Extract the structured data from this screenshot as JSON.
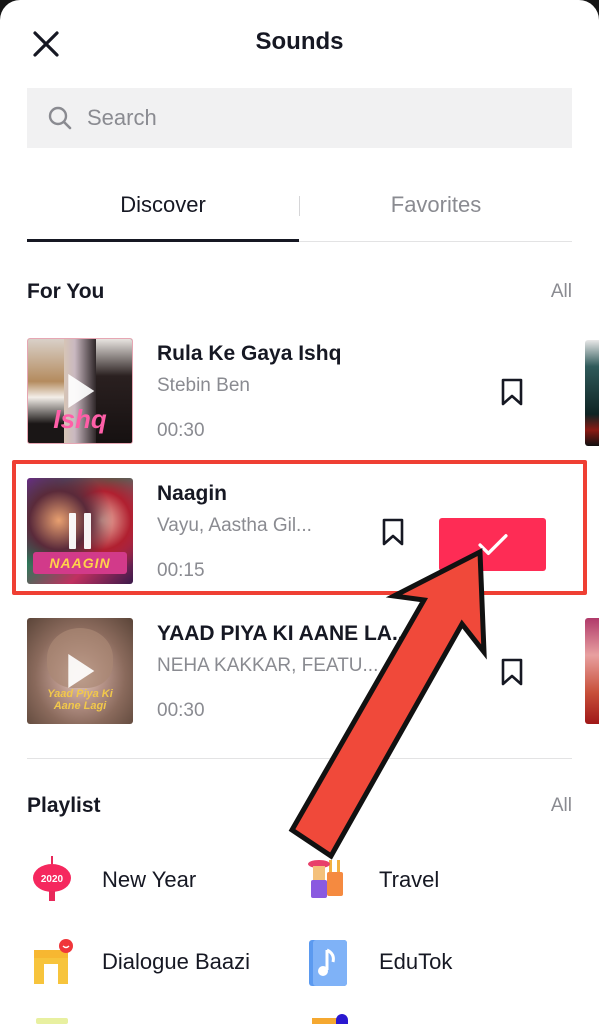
{
  "header": {
    "title": "Sounds",
    "close_icon": "close-icon"
  },
  "search": {
    "placeholder": "Search",
    "value": "",
    "icon": "search-icon"
  },
  "tabs": [
    {
      "label": "Discover",
      "active": true
    },
    {
      "label": "Favorites",
      "active": false
    }
  ],
  "for_you": {
    "title": "For You",
    "all_label": "All",
    "songs": [
      {
        "title": "Rula Ke Gaya Ishq",
        "artist": "Stebin Ben",
        "duration": "00:30",
        "state": "play",
        "cover_text": "Ishq"
      },
      {
        "title": "Naagin",
        "artist": "Vayu, Aastha Gil...",
        "duration": "00:15",
        "state": "pause",
        "selected": true,
        "cover_text": "NAAGIN",
        "use_icon": "check-icon"
      },
      {
        "title": "YAAD PIYA KI AANE LA...",
        "artist": "NEHA KAKKAR, FEATU...",
        "duration": "00:30",
        "state": "play",
        "cover_text": "Yaad Piya Ki Aane Lagi"
      }
    ]
  },
  "playlist": {
    "title": "Playlist",
    "all_label": "All",
    "items": [
      {
        "label": "New Year",
        "icon": "lantern-2020-icon",
        "badge": "2020"
      },
      {
        "label": "Travel",
        "icon": "traveler-luggage-icon"
      },
      {
        "label": "Dialogue Baazi",
        "icon": "gate-smiley-icon"
      },
      {
        "label": "EduTok",
        "icon": "music-book-icon"
      }
    ]
  },
  "annotation": {
    "highlight_color": "#ef3f33",
    "arrow_color": "#f0493a"
  },
  "colors": {
    "accent": "#fe2c55",
    "primary_text": "#161823",
    "secondary_text": "#8a8b91"
  }
}
